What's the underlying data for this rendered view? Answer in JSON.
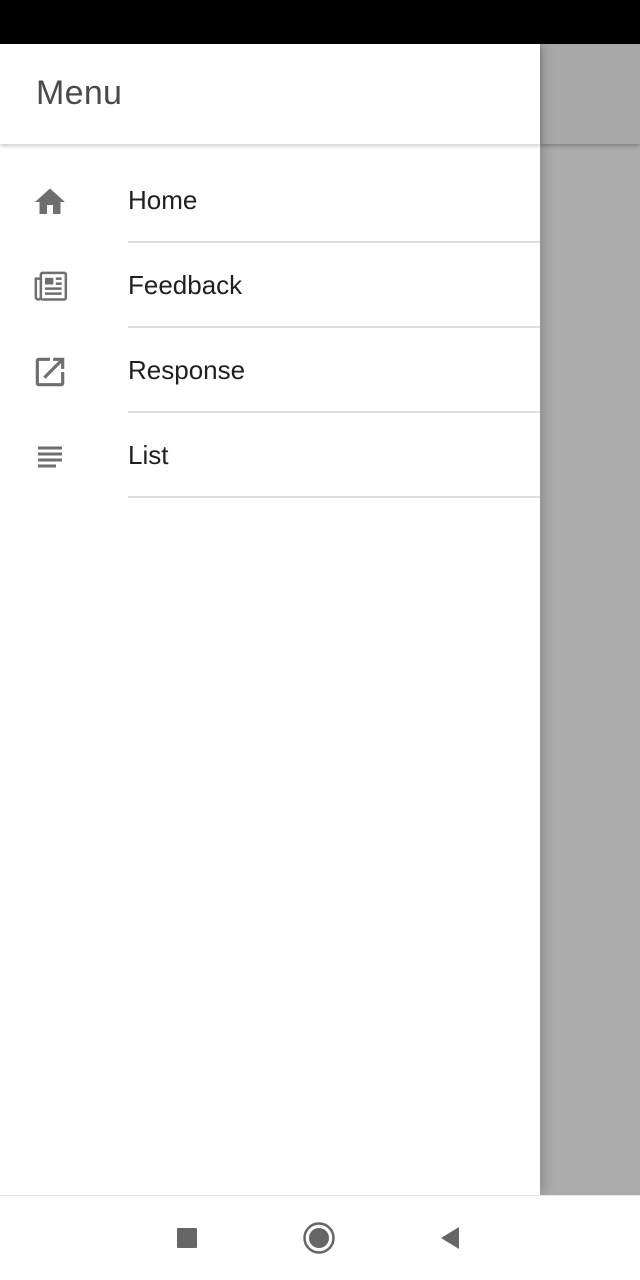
{
  "drawer": {
    "title": "Menu",
    "items": [
      {
        "label": "Home",
        "icon": "home-icon"
      },
      {
        "label": "Feedback",
        "icon": "newspaper-icon"
      },
      {
        "label": "Response",
        "icon": "open-in-new-icon"
      },
      {
        "label": "List",
        "icon": "list-icon"
      }
    ]
  },
  "nav_bar": {
    "buttons": [
      "recents-icon",
      "home-circle-icon",
      "back-icon"
    ]
  },
  "colors": {
    "status_bar": "#000000",
    "scrim": "#acacac",
    "icon": "#6e6e6e",
    "divider": "#dedede"
  }
}
